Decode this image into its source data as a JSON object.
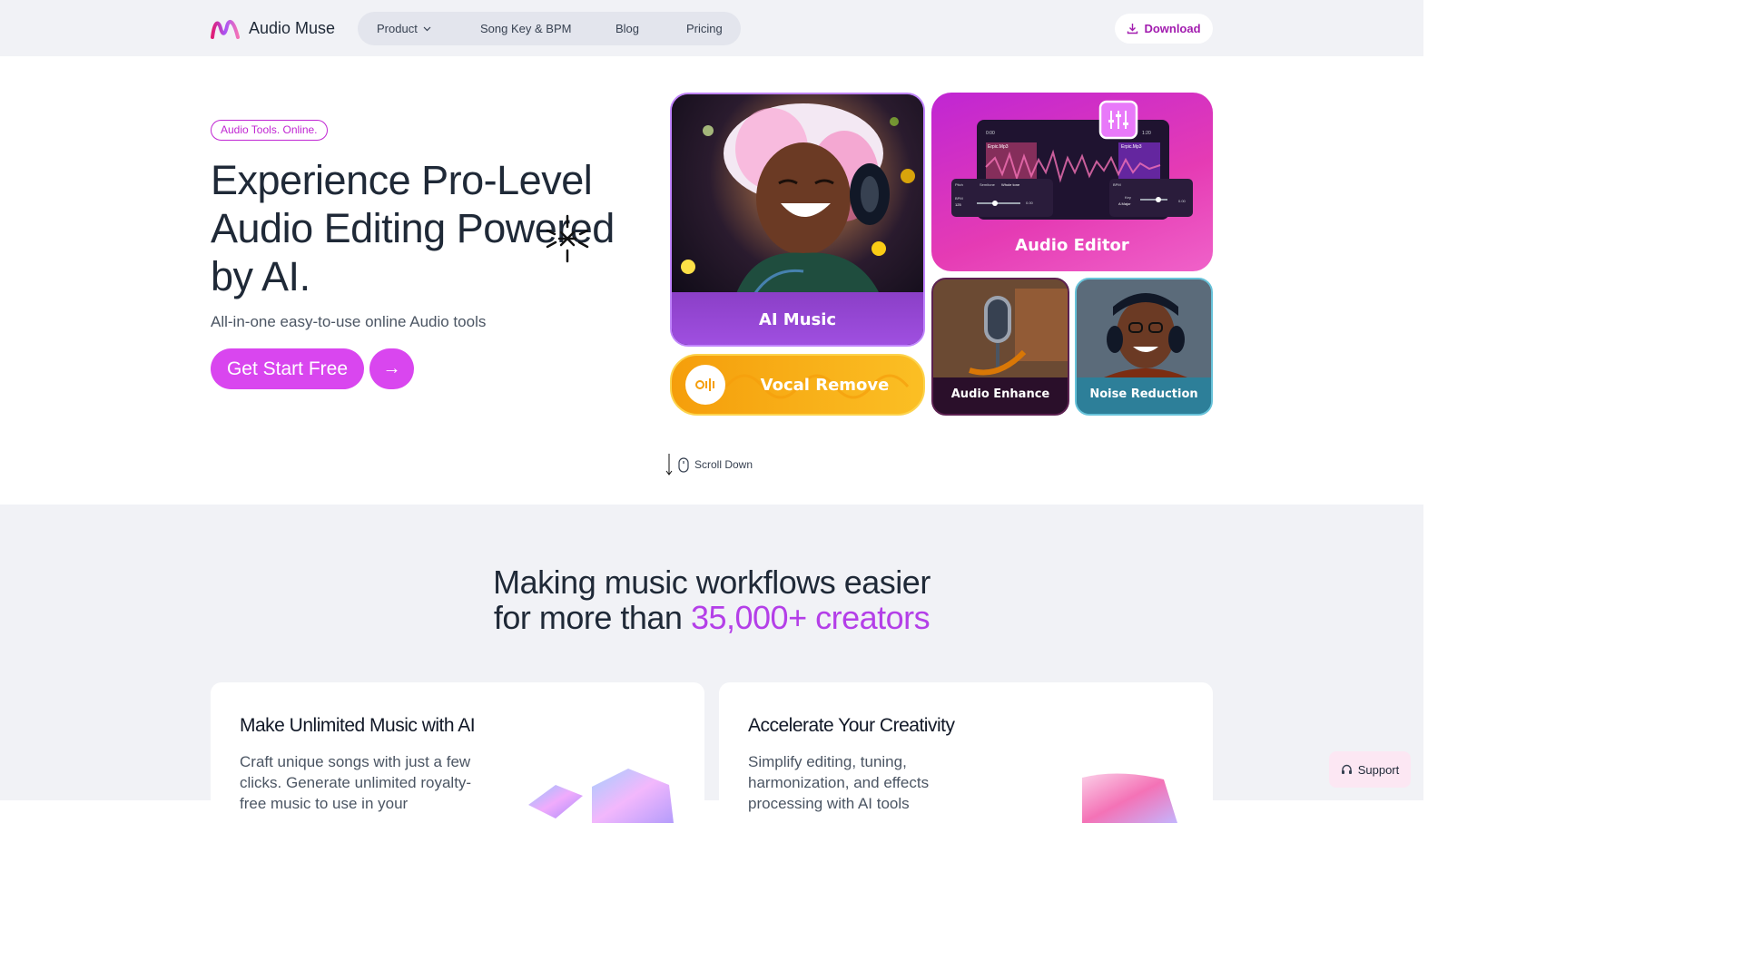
{
  "header": {
    "brand": "Audio Muse",
    "nav": {
      "product": "Product",
      "song_key": "Song Key & BPM",
      "blog": "Blog",
      "pricing": "Pricing"
    },
    "download": "Download"
  },
  "hero": {
    "tag": "Audio Tools. Online.",
    "title": "Experience Pro-Level Audio Editing Powered by AI.",
    "subtitle": "All-in-one easy-to-use online Audio tools",
    "cta": "Get Start Free",
    "cta_arrow": "→"
  },
  "tiles": {
    "ai_music": "AI Music",
    "audio_editor": "Audio Editor",
    "vocal_remove": "Vocal Remove",
    "audio_enhance": "Audio Enhance",
    "noise_reduction": "Noise Reduction",
    "editor_file_a": "Erpic.Mp3",
    "editor_file_b": "Erpic.Mp3",
    "editor_time_start": "0:00",
    "editor_time_end": "1:20",
    "editor_pitch": "Pitch",
    "editor_semitone": "Semitone",
    "editor_whole_tone": "Whole tone",
    "editor_bpm": "BPM",
    "editor_bpm_val": "125",
    "editor_key": "Key",
    "editor_key_val": "A Major",
    "editor_zero_a": "0.00",
    "editor_zero_b": "0.00"
  },
  "scroll_down": "Scroll Down",
  "section2": {
    "title_line1": "Making music workflows easier",
    "title_line2_prefix": "for more than ",
    "title_line2_accent": "35,000+ creators"
  },
  "cards": [
    {
      "title": "Make Unlimited Music with AI",
      "text": "Craft unique songs with just a few clicks. Generate unlimited royalty-free music to use in your"
    },
    {
      "title": "Accelerate Your Creativity",
      "text": "Simplify editing, tuning, harmonization, and effects processing with AI tools"
    }
  ],
  "support": "Support",
  "colors": {
    "accent": "#d946ef",
    "brand_purple": "#b43fe8",
    "download_text": "#a21caf"
  }
}
